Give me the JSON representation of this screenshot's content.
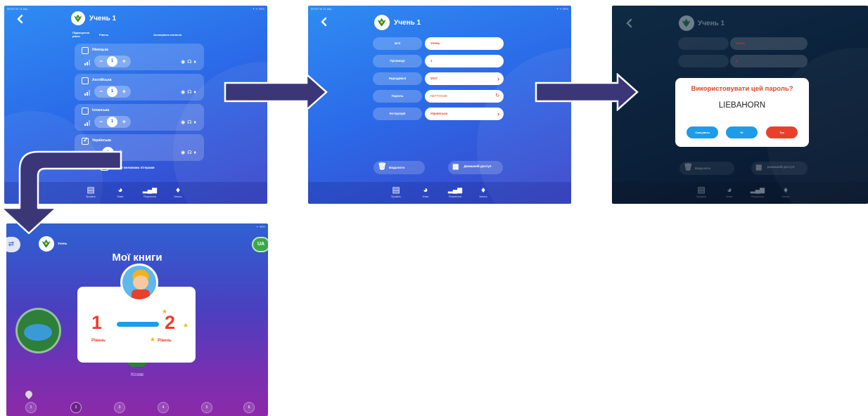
{
  "screen1": {
    "status_left": "09:59  Пн 21 вер.",
    "status_right": "✦ ᯤ 98%",
    "title": "Учень 1",
    "col_head_level": "Підвищення рівня",
    "col_head_level2": "Рівень",
    "col_head_activate": "Активувати питання",
    "subjects": [
      {
        "name": "Німецька",
        "checked": false,
        "level": "1"
      },
      {
        "name": "Англійська",
        "checked": false,
        "level": "1"
      },
      {
        "name": "Іспанська",
        "checked": false,
        "level": "1"
      },
      {
        "name": "Українська",
        "checked": true,
        "level": "1"
      }
    ],
    "word_option": "Текст великими літерами",
    "tabs": [
      "Профіль",
      "Мови",
      "Результати",
      "Запись"
    ]
  },
  "screen2": {
    "status_left": "09:59  Пн 21 вер.",
    "status_right": "✦ ᯤ 98%",
    "title": "Учень 1",
    "fields": [
      {
        "label": "Ім'я",
        "value": "Учень",
        "chevron": false
      },
      {
        "label": "Прізвище",
        "value": "1",
        "chevron": false
      },
      {
        "label": "Народився",
        "value": "2017",
        "chevron": true
      },
      {
        "label": "Пароль",
        "value": "NETTHASE",
        "chevron": false
      },
      {
        "label": "Інструкція",
        "value": "Українська",
        "chevron": true
      }
    ],
    "delete_label": "Видалити",
    "home_access_label": "Домашній доступ",
    "tabs": [
      "Профіль",
      "Мови",
      "Результати",
      "Запись"
    ]
  },
  "screen3": {
    "title": "Учень 1",
    "dialog_question": "Використовувати цей пароль?",
    "dialog_password": "LIEBAHORN",
    "cancel_label": "Скасувати",
    "no_label": "Ні",
    "yes_label": "Так",
    "bg_field1": "Учень",
    "bg_field2": "1",
    "bg_delete": "Видалити",
    "bg_home": "Домашній доступ",
    "tabs": [
      "Профіль",
      "Мови",
      "Результати",
      "Запись"
    ]
  },
  "screen4": {
    "status_right": "ᯤ 98%",
    "user_name": "Учень",
    "lang_badge": "UA",
    "heading": "Мої книги",
    "level_from": "1",
    "level_to": "2",
    "level_label": "Рівень",
    "book_caption": "Козак",
    "pages": [
      "1",
      "2",
      "3",
      "4",
      "5",
      "6"
    ]
  },
  "colors": {
    "accent_red": "#e8412b",
    "blue_btn": "#1e9be9",
    "dialog_yes": "#e8412b"
  }
}
